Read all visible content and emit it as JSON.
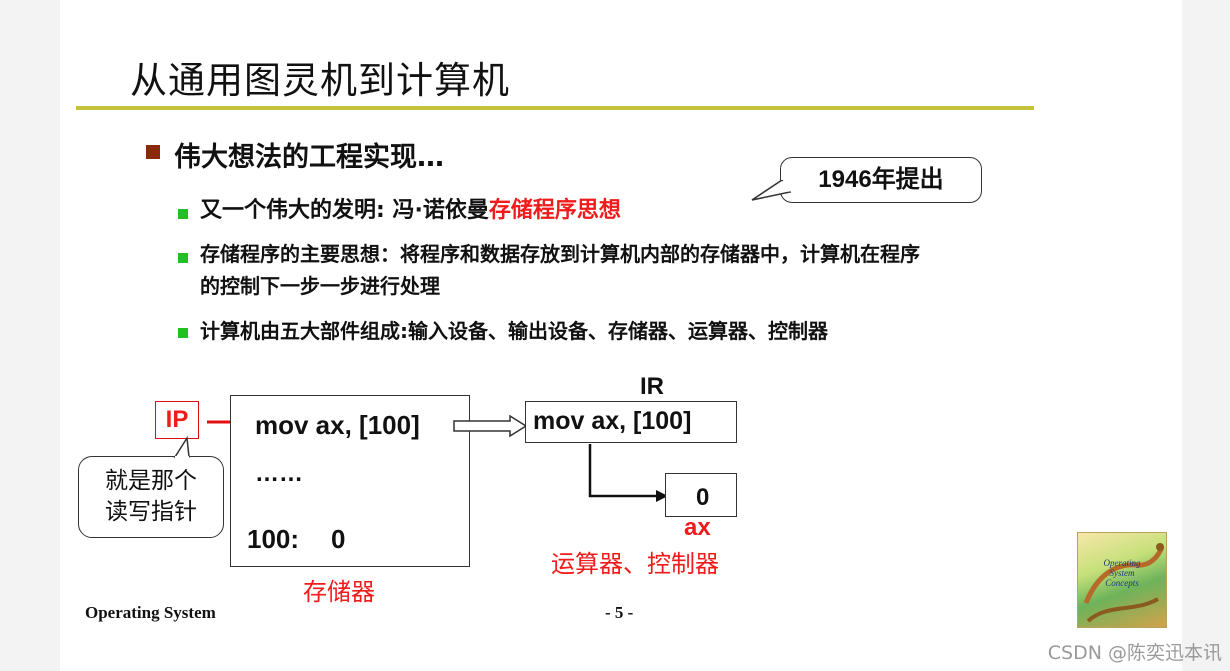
{
  "slide": {
    "title": "从通用图灵机到计算机",
    "bullet1": "伟大想法的工程实现…",
    "sub1_prefix": "又一个伟大的发明: 冯·诺依曼",
    "sub1_highlight": "存储程序思想",
    "sub2_line1": "存储程序的主要思想：将程序和数据存放到计算机内部的存储器中，计算机在程序",
    "sub2_line2": "的控制下一步一步进行处理",
    "sub3": "计算机由五大部件组成:输入设备、输出设备、存储器、运算器、控制器",
    "callout": "1946年提出"
  },
  "diagram": {
    "ip_label": "IP",
    "pointer_line1": "就是那个",
    "pointer_line2": "读写指针",
    "memory_instruction": "mov ax, [100]",
    "memory_ellipsis": "……",
    "memory_addr": "100:",
    "memory_value": "0",
    "memory_label": "存储器",
    "ir_label": "IR",
    "ir_instruction": "mov ax, [100]",
    "ax_value": "0",
    "ax_label": "ax",
    "alu_label": "运算器、控制器",
    "colors": {
      "accent_red": "#f01b1b",
      "title_rule": "#c4c33b",
      "bullet_green": "#22c022",
      "bullet_brown": "#8b2a0a"
    }
  },
  "footer": {
    "left": "Operating System",
    "page": "- 5 -"
  },
  "book": {
    "line1": "Operating",
    "line2": "System",
    "line3": "Concepts"
  },
  "watermark": "CSDN @陈奕迅本讯"
}
